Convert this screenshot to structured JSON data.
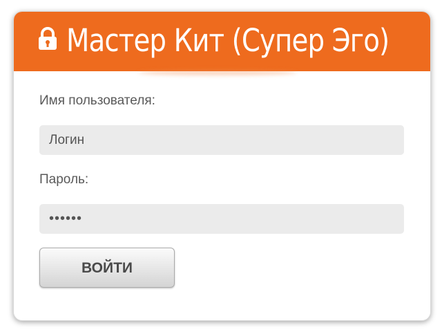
{
  "header": {
    "title": "Мастер Кит (Супер Эго)",
    "icon": "lock-icon",
    "background_color": "#ee6b1e"
  },
  "form": {
    "username_label": "Имя пользователя:",
    "username_value": "Логин",
    "password_label": "Пароль:",
    "password_value": "••••••",
    "submit_label": "ВОЙТИ"
  }
}
